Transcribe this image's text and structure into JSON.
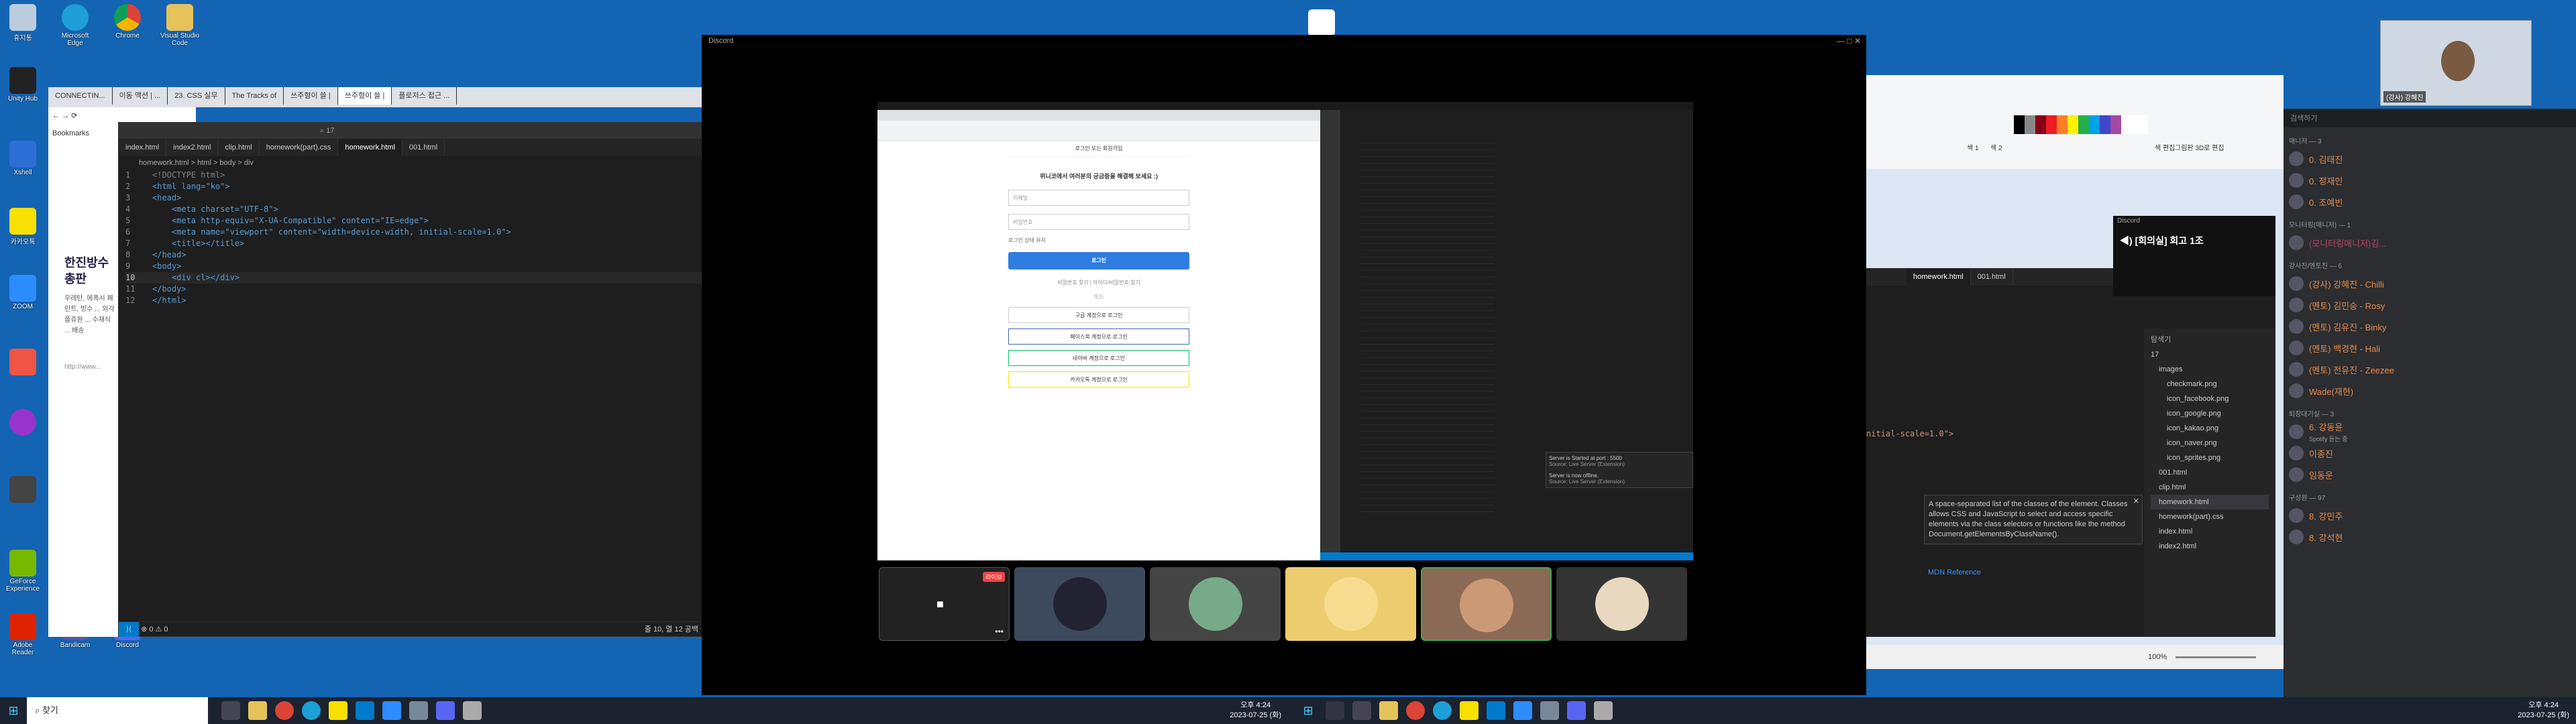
{
  "desktop": {
    "icons": [
      {
        "label": "휴지통"
      },
      {
        "label": "Microsoft Edge"
      },
      {
        "label": "Chrome"
      },
      {
        "label": "Visual Studio Code"
      },
      {
        "label": "Unity Hub"
      },
      {
        "label": "Xshell"
      },
      {
        "label": "카카오톡"
      },
      {
        "label": "ZOOM"
      },
      {
        "label": "GeForce Experience"
      },
      {
        "label": "Adobe Reader"
      },
      {
        "label": "Bandicam"
      },
      {
        "label": "Discord"
      }
    ]
  },
  "browser": {
    "tabs": [
      "CONNECTIN...",
      "이동 액션 | ...",
      "23. CSS 실무",
      "The Tracks of",
      "쓰주형이 쓸 |",
      "쓰주형이 쓸 |",
      "플로저스 접근 ..."
    ],
    "bookmarks": "Bookmarks",
    "page_title": "한진방수 총판",
    "page_text": "우레탄, 에폭시 페인트, 방수 ... 외각플쥬원 ... 수재식 ... 배송",
    "url_hint": "http://www...",
    "address": "1"
  },
  "vscode": {
    "title": "17",
    "tabs": [
      "index.html",
      "index2.html",
      "clip.html",
      "homework(part).css",
      "homework.html",
      "001.html"
    ],
    "breadcrumb": "homework.html > html > body > div",
    "lines": [
      "<!DOCTYPE html>",
      "<html lang=\"ko\">",
      "<head>",
      "    <meta charset=\"UTF-8\">",
      "    <meta http-equiv=\"X-UA-Compatible\" content=\"IE=edge\">",
      "    <meta name=\"viewport\" content=\"width=device-width, initial-scale=1.0\">",
      "    <title></title>",
      "</head>",
      "<body>",
      "    <div cl></div>",
      "</body>",
      "</html>"
    ],
    "status_left": "⊗ 0 ⚠ 0",
    "status_right": "줄 10, 열 12   공백"
  },
  "discord": {
    "title": "Discord",
    "shared": {
      "login_title": "로그인 또는 회원가입",
      "question": "위니코에서 여러분의 궁금증을 해결해 보세요 :)",
      "email_ph": "이메일",
      "password_ph": "비밀번호",
      "keep": "로그인 상태 유지",
      "login_btn": "로그인",
      "find": "비밀번호 찾기 | 아이디/비밀번호 찾기",
      "or": "또는",
      "social": [
        "구글 계정으로 로그인",
        "페이스북 계정으로 로그인",
        "네이버 계정으로 로그인",
        "카카오톡 계정으로 로그인"
      ],
      "server_msg1": "Server is Started at port : 5500",
      "server_src": "Source: Live Server (Extension)",
      "server_msg2": "Server is now offline."
    },
    "live_badge": "라이브"
  },
  "vscode2": {
    "tabs": [
      "homework.html",
      "001.html"
    ],
    "explorer_title": "탐색기",
    "folder": "17",
    "files": [
      "images",
      "checkmark.png",
      "icon_facebook.png",
      "icon_google.png",
      "icon_kakao.png",
      "icon_naver.png",
      "icon_sprites.png",
      "001.html",
      "clip.html",
      "homework.html",
      "homework(part).css",
      "index.html",
      "index2.html"
    ],
    "code_fragment": "nitial-scale=1.0\">",
    "tooltip": "A space-separated list of the classes of the element. Classes allows CSS and JavaScript to select and access specific elements via the class selectors or functions like the method Document.getElementsByClassName().",
    "mdn": "MDN Reference"
  },
  "paint": {
    "labels": [
      "색 1",
      "색 2",
      "색 편집",
      "그림판 3D로 편집"
    ],
    "zoom": "100%"
  },
  "mini_discord": {
    "title": "Discord",
    "channel": "[회의실] 회고 1조"
  },
  "member_list": {
    "search_ph": "검색하기",
    "sections": [
      {
        "title": "매니저 — 3",
        "members": [
          "0. 김태진",
          "0. 정재인",
          "0. 조예빈"
        ]
      },
      {
        "title": "모니터링(매니저) — 1",
        "members": [
          "(모니터링매니저)김..."
        ]
      },
      {
        "title": "강사진/멘토진 — 6",
        "members": [
          "(강사) 강혜진 - Chilli",
          "(멘토) 김민승 - Rosy",
          "(멘토) 김유진 - Binky",
          "(멘토) 백경현 - Hali",
          "(멘토) 전유진 - Zeezee",
          "Wade(재현)"
        ]
      },
      {
        "title": "퇴장대기실 — 3",
        "members": [
          "6. 강동윤",
          "이종진",
          "임동운"
        ]
      },
      {
        "title": "구성원 — 97",
        "members": [
          "8. 강민주",
          "8. 강석현"
        ]
      }
    ],
    "spotify": "Spotify 듣는 중"
  },
  "zoom_overlay": {
    "name": "(강사) 강혜진"
  },
  "taskbar": {
    "search": "찾기",
    "time1": "오후 4:24",
    "date1": "2023-07-25 (화)",
    "time2": "오후 4:24",
    "date2": "2023-07-25 (화)"
  }
}
